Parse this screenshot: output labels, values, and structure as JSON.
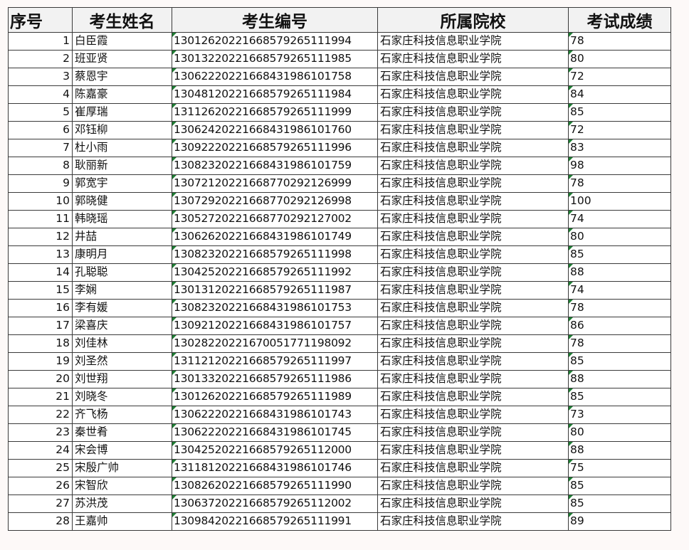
{
  "headers": {
    "seq": "序号",
    "name": "考生姓名",
    "exam_id": "考生编号",
    "school": "所属院校",
    "score": "考试成绩"
  },
  "rows": [
    {
      "seq": "1",
      "name": "白臣霞",
      "exam_id": "130126202216685792651119​94",
      "school": "石家庄科技信息职业学院",
      "score": "78"
    },
    {
      "seq": "2",
      "name": "班亚贤",
      "exam_id": "130132202216685792651119​85",
      "school": "石家庄科技信息职业学院",
      "score": "80"
    },
    {
      "seq": "3",
      "name": "蔡恩宇",
      "exam_id": "130622202216684319861017​58",
      "school": "石家庄科技信息职业学院",
      "score": "72"
    },
    {
      "seq": "4",
      "name": "陈嘉豪",
      "exam_id": "130481202216685792651119​84",
      "school": "石家庄科技信息职业学院",
      "score": "84"
    },
    {
      "seq": "5",
      "name": "崔厚瑞",
      "exam_id": "131126202216685792651119​99",
      "school": "石家庄科技信息职业学院",
      "score": "85"
    },
    {
      "seq": "6",
      "name": "邓钰柳",
      "exam_id": "130624202216684319861017​60",
      "school": "石家庄科技信息职业学院",
      "score": "72"
    },
    {
      "seq": "7",
      "name": "杜小雨",
      "exam_id": "130922202216685792651119​96",
      "school": "石家庄科技信息职业学院",
      "score": "83"
    },
    {
      "seq": "8",
      "name": "耿丽新",
      "exam_id": "130823202216684319861017​59",
      "school": "石家庄科技信息职业学院",
      "score": "98"
    },
    {
      "seq": "9",
      "name": "郭宽宇",
      "exam_id": "130721202216687702921269​99",
      "school": "石家庄科技信息职业学院",
      "score": "78"
    },
    {
      "seq": "10",
      "name": "郭晓健",
      "exam_id": "130729202216687702921269​98",
      "school": "石家庄科技信息职业学院",
      "score": "100"
    },
    {
      "seq": "11",
      "name": "韩晓瑶",
      "exam_id": "130527202216687702921270​02",
      "school": "石家庄科技信息职业学院",
      "score": "74"
    },
    {
      "seq": "12",
      "name": "井喆",
      "exam_id": "130626202216684319861017​49",
      "school": "石家庄科技信息职业学院",
      "score": "80"
    },
    {
      "seq": "13",
      "name": "康明月",
      "exam_id": "130823202216685792651119​98",
      "school": "石家庄科技信息职业学院",
      "score": "85"
    },
    {
      "seq": "14",
      "name": "孔聪聪",
      "exam_id": "130425202216685792651119​92",
      "school": "石家庄科技信息职业学院",
      "score": "88"
    },
    {
      "seq": "15",
      "name": "李娴",
      "exam_id": "130131202216685792651119​87",
      "school": "石家庄科技信息职业学院",
      "score": "74"
    },
    {
      "seq": "16",
      "name": "李有媛",
      "exam_id": "130823202216684319861017​53",
      "school": "石家庄科技信息职业学院",
      "score": "78"
    },
    {
      "seq": "17",
      "name": "梁喜庆",
      "exam_id": "130921202216684319861017​57",
      "school": "石家庄科技信息职业学院",
      "score": "86"
    },
    {
      "seq": "18",
      "name": "刘佳林",
      "exam_id": "130282202216700517711980​92",
      "school": "石家庄科技信息职业学院",
      "score": "78"
    },
    {
      "seq": "19",
      "name": "刘圣然",
      "exam_id": "131121202216685792651119​97",
      "school": "石家庄科技信息职业学院",
      "score": "85"
    },
    {
      "seq": "20",
      "name": "刘世翔",
      "exam_id": "130133202216685792651119​86",
      "school": "石家庄科技信息职业学院",
      "score": "88"
    },
    {
      "seq": "21",
      "name": "刘晓冬",
      "exam_id": "130126202216685792651119​89",
      "school": "石家庄科技信息职业学院",
      "score": "85"
    },
    {
      "seq": "22",
      "name": "齐飞杨",
      "exam_id": "130622202216684319861017​43",
      "school": "石家庄科技信息职业学院",
      "score": "73"
    },
    {
      "seq": "23",
      "name": "秦世肴",
      "exam_id": "130622202216684319861017​45",
      "school": "石家庄科技信息职业学院",
      "score": "80"
    },
    {
      "seq": "24",
      "name": "宋会博",
      "exam_id": "130425202216685792651120​00",
      "school": "石家庄科技信息职业学院",
      "score": "88"
    },
    {
      "seq": "25",
      "name": "宋殷广帅",
      "exam_id": "131181202216684319861017​46",
      "school": "石家庄科技信息职业学院",
      "score": "75"
    },
    {
      "seq": "26",
      "name": "宋智欣",
      "exam_id": "130826202216685792651119​90",
      "school": "石家庄科技信息职业学院",
      "score": "85"
    },
    {
      "seq": "27",
      "name": "苏洪茂",
      "exam_id": "130637202216685792651120​02",
      "school": "石家庄科技信息职业学院",
      "score": "85"
    },
    {
      "seq": "28",
      "name": "王嘉帅",
      "exam_id": "130984202216685792651119​91",
      "school": "石家庄科技信息职业学院",
      "score": "89"
    }
  ]
}
